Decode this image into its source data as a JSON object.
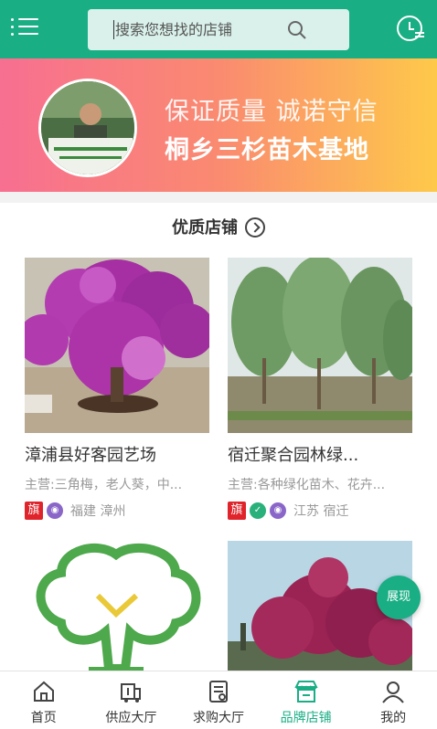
{
  "search": {
    "placeholder": "搜索您想找的店铺"
  },
  "banner": {
    "line1": "保证质量  诚诺守信",
    "line2": "桐乡三杉苗木基地"
  },
  "section": {
    "title": "优质店铺"
  },
  "shops": [
    {
      "name": "漳浦县好客园艺场",
      "main": "主营:三角梅，老人葵，中...",
      "flag": "旗",
      "location": "福建 漳州"
    },
    {
      "name": "宿迁聚合园林绿...",
      "main": "主营:各种绿化苗木、花卉...",
      "flag": "旗",
      "location": "江苏 宿迁"
    }
  ],
  "float_button": {
    "label": "展现"
  },
  "nav": [
    {
      "label": "首页",
      "icon": "home-icon"
    },
    {
      "label": "供应大厅",
      "icon": "supply-icon"
    },
    {
      "label": "求购大厅",
      "icon": "purchase-icon"
    },
    {
      "label": "品牌店铺",
      "icon": "shop-icon",
      "active": true
    },
    {
      "label": "我的",
      "icon": "user-icon"
    }
  ],
  "colors": {
    "primary": "#1aae84",
    "flag": "#e0242b",
    "badge_purple": "#8a66c9",
    "badge_green": "#2ab07a"
  }
}
